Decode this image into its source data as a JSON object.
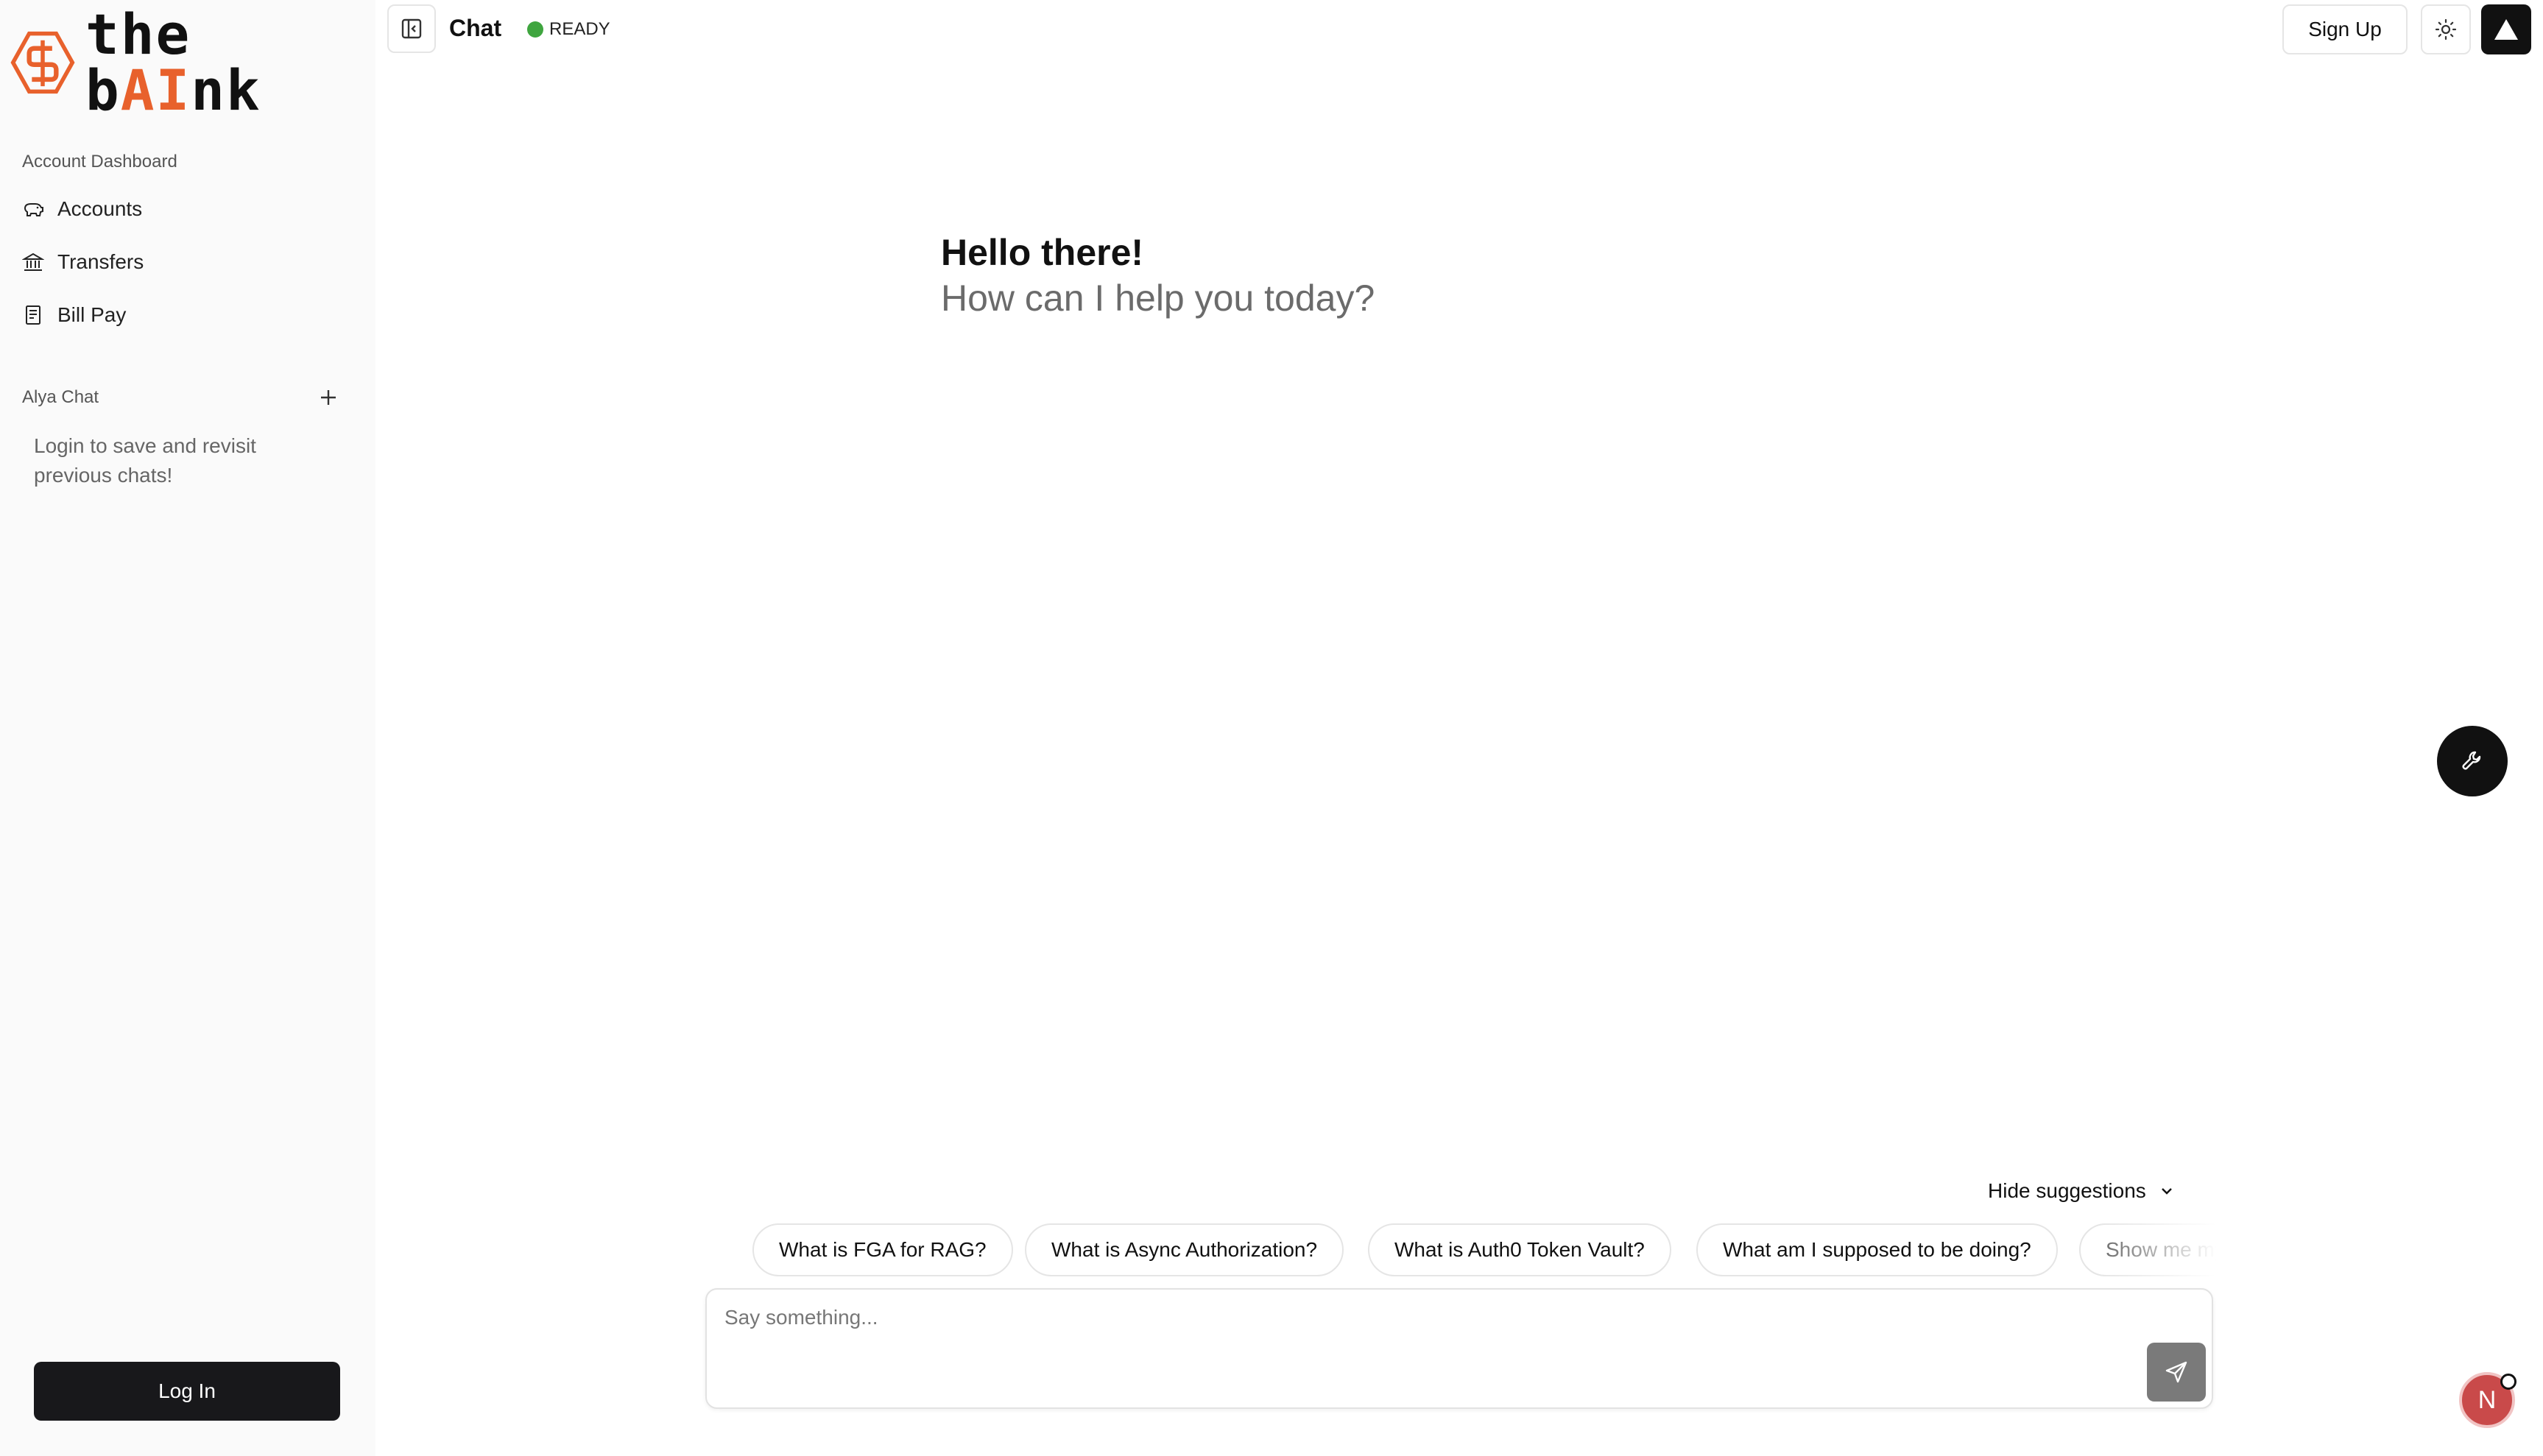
{
  "brand": {
    "name_part1": "the b",
    "name_ai": "AI",
    "name_part2": "nk",
    "accent_color": "#e8612c"
  },
  "sidebar": {
    "section_dashboard": "Account Dashboard",
    "items": [
      {
        "label": "Accounts",
        "icon": "piggy-bank-icon"
      },
      {
        "label": "Transfers",
        "icon": "bank-icon"
      },
      {
        "label": "Bill Pay",
        "icon": "receipt-icon"
      }
    ],
    "section_chat": "Alya Chat",
    "login_hint": "Login to save and revisit previous chats!",
    "login_button": "Log In"
  },
  "header": {
    "title": "Chat",
    "status": "READY",
    "signup_button": "Sign Up"
  },
  "greeting": {
    "title": "Hello there!",
    "subtitle": "How can I help you today?"
  },
  "suggestions": {
    "toggle_label": "Hide suggestions",
    "chips": [
      "What is FGA for RAG?",
      "What is Async Authorization?",
      "What is Auth0 Token Vault?",
      "What am I supposed to be doing?",
      "Show me my accounts"
    ]
  },
  "composer": {
    "placeholder": "Say something..."
  },
  "avatar": {
    "initial": "N"
  }
}
